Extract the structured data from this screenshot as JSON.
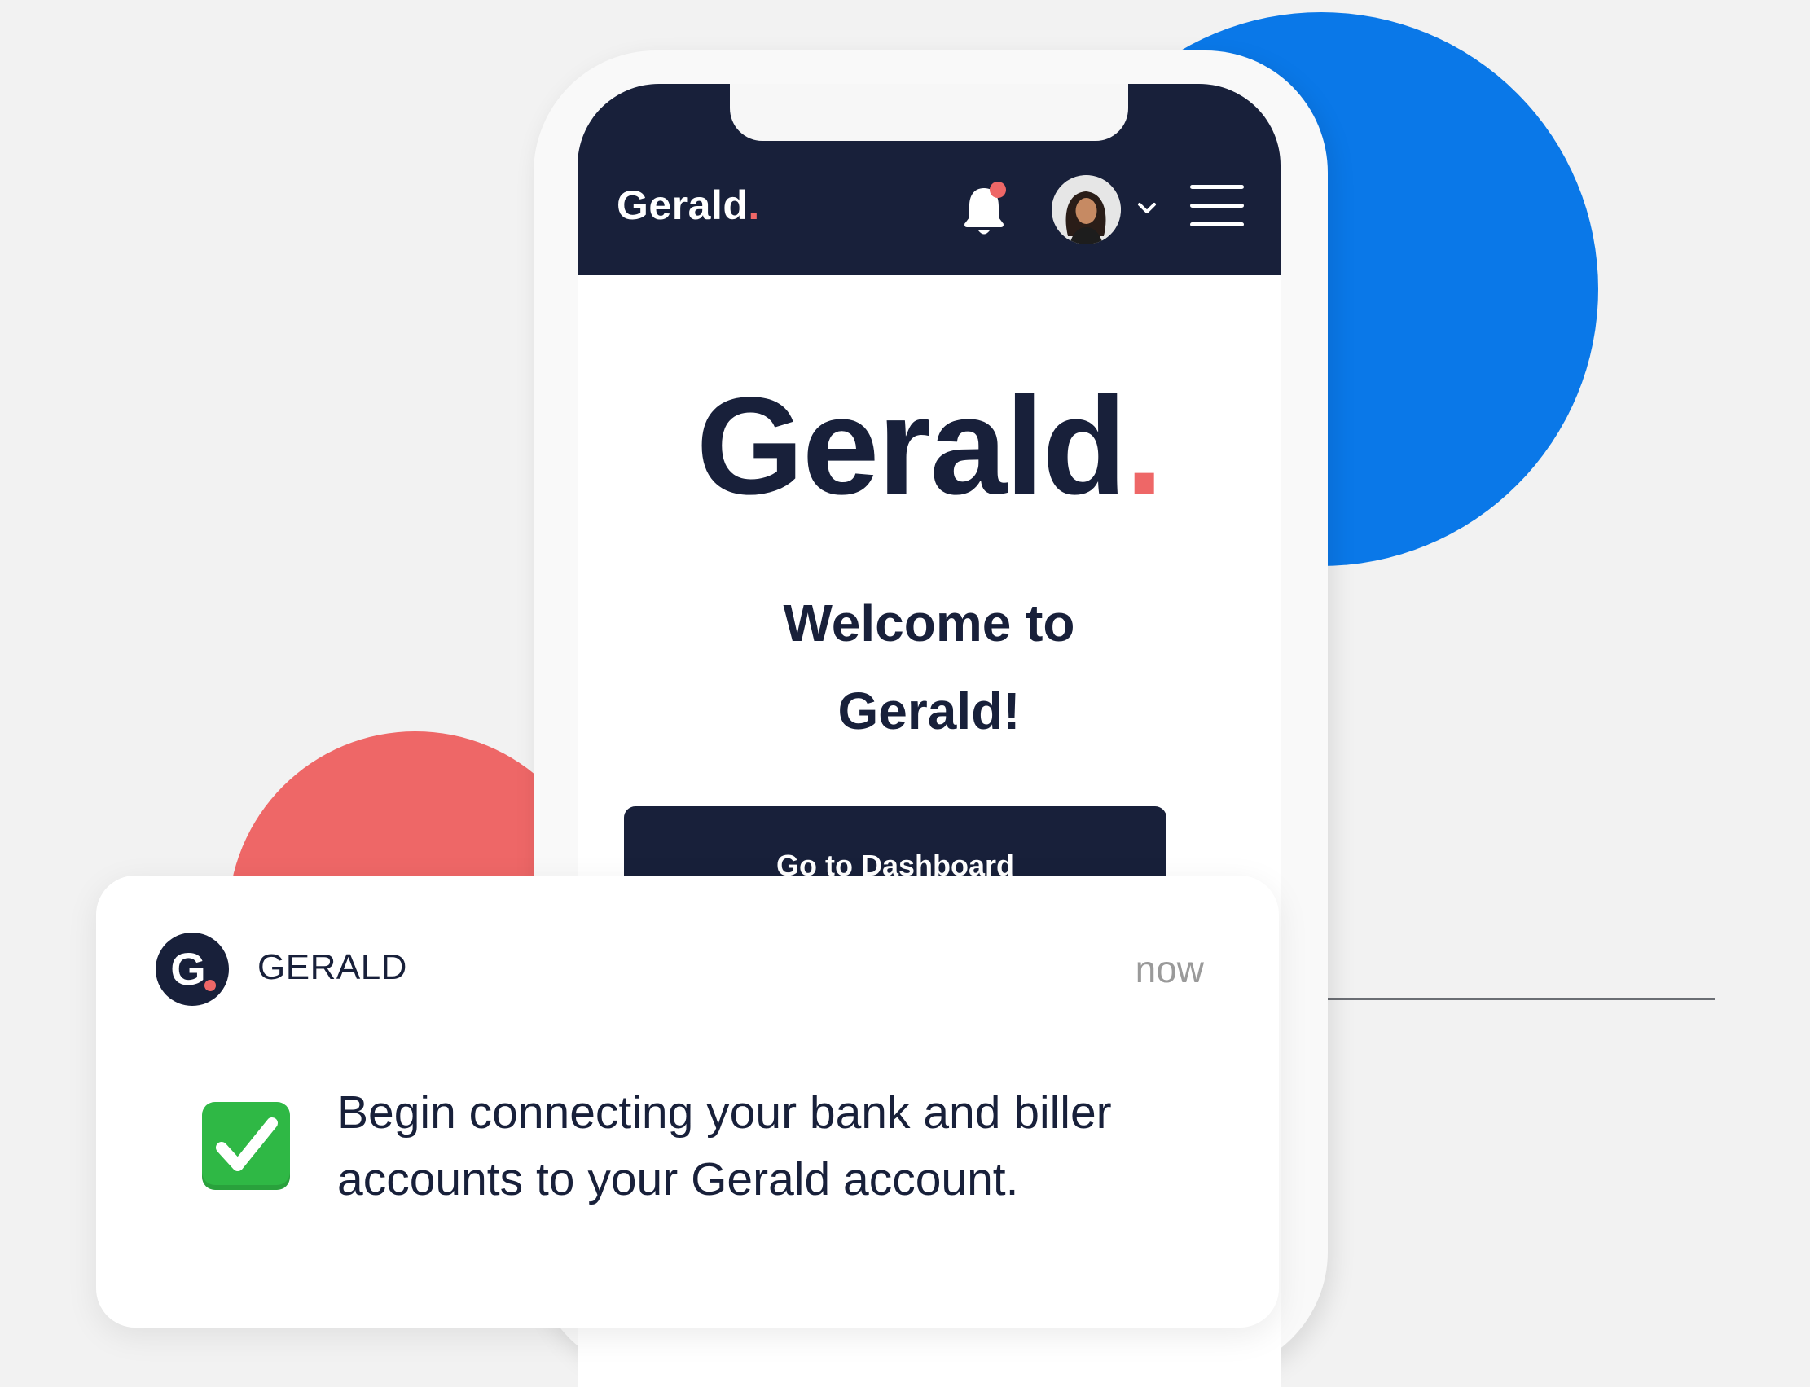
{
  "colors": {
    "navy": "#18203a",
    "accent_red": "#ee6767",
    "accent_blue": "#0a78e8",
    "check_green": "#2fb845"
  },
  "phone": {
    "header": {
      "logo_text": "Gerald",
      "logo_dot": ".",
      "icons": [
        "bell-icon",
        "avatar",
        "chevron-down-icon",
        "hamburger-menu-icon"
      ],
      "has_unread_notification": true
    },
    "main": {
      "brand_text": "Gerald",
      "brand_dot": ".",
      "welcome_line1": "Welcome to",
      "welcome_line2": "Gerald!",
      "cta_label": "Go to Dashboard"
    }
  },
  "notification": {
    "app_icon_letter": "G",
    "app_name": "GERALD",
    "time": "now",
    "icon": "check-mark-icon",
    "message": "Begin connecting your bank and biller accounts to your Gerald account."
  }
}
